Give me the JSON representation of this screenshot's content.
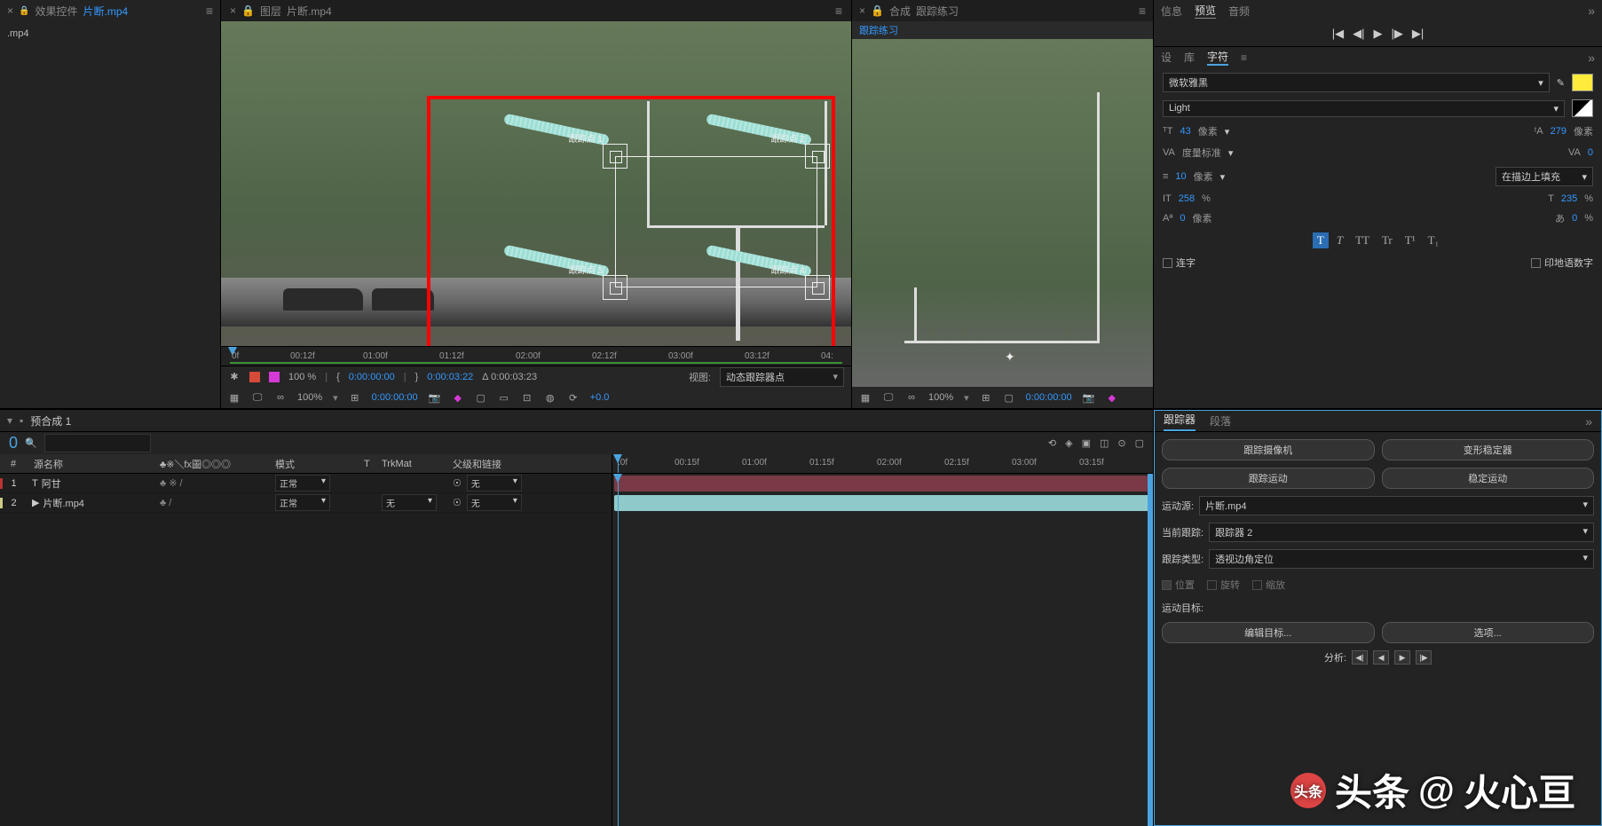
{
  "left_panel": {
    "tab_prefix": "效果控件",
    "tab_file": "片断.mp4",
    "item": ".mp4"
  },
  "center_panel": {
    "tab_prefix": "图层",
    "tab_file": "片断.mp4"
  },
  "track_points": {
    "p1": "跟踪点 1",
    "p2": "跟踪点 2",
    "p3": "跟踪点 3",
    "p4": "跟踪点 4"
  },
  "center_ruler": [
    "0f",
    "00:12f",
    "01:00f",
    "01:12f",
    "02:00f",
    "02:12f",
    "03:00f",
    "03:12f",
    "04:"
  ],
  "viewer_toolbar": {
    "pct": "100 %",
    "bracket_time": "0:00:00:00",
    "time2": "0:00:03:22",
    "delta": "Δ 0:00:03:23",
    "view_label": "视图:",
    "view_value": "动态跟踪器点"
  },
  "bottom_toolbar": {
    "zoom": "100%",
    "time": "0:00:00:00",
    "offset": "+0.0"
  },
  "comp_panel": {
    "tab_prefix": "合成",
    "tab_name": "跟踪练习",
    "subtab": "跟踪练习"
  },
  "comp_toolbar": {
    "zoom": "100%",
    "time": "0:00:00:00"
  },
  "top_side_tabs": {
    "info": "信息",
    "preview": "预览",
    "audio": "音频"
  },
  "char_side_tabs": {
    "design": "设",
    "library": "库",
    "char": "字符"
  },
  "char_panel": {
    "font": "微软雅黑",
    "weight": "Light",
    "size_val": "43",
    "size_unit": "像素",
    "lead_val": "279",
    "lead_unit": "像素",
    "kern": "度量标准",
    "track_val": "0",
    "stroke_val": "10",
    "stroke_unit": "像素",
    "stroke_opt": "在描边上填充",
    "vscale": "258",
    "hscale": "235",
    "pct": "%",
    "baseline": "0",
    "baseline_unit": "像素",
    "tsume": "0",
    "tsume_pct": "%",
    "ligatures": "连字",
    "hindi": "印地语数字"
  },
  "style_btns": {
    "t": "T",
    "i": "T",
    "tt": "TT",
    "tr": "Tr",
    "t1": "T¹",
    "t2": "T₁"
  },
  "timeline": {
    "tab": "预合成 1",
    "search_ph": "",
    "headers": {
      "num": "#",
      "src": "源名称",
      "switches": "♣※＼fx圖◎◎◎",
      "mode": "模式",
      "t": "T",
      "trkmat": "TrkMat",
      "parent": "父级和链接"
    },
    "row1": {
      "num": "1",
      "name": "阿甘",
      "sw": "♣  ※ /",
      "mode": "正常",
      "trkmat": "",
      "parent_val": "无"
    },
    "row2": {
      "num": "2",
      "name": "片断.mp4",
      "sw": "♣    /",
      "mode": "正常",
      "trkmat": "无",
      "parent_val": "无"
    },
    "ruler": [
      ":0f",
      "00:15f",
      "01:00f",
      "01:15f",
      "02:00f",
      "02:15f",
      "03:00f",
      "03:15f"
    ],
    "link_sym": "☉"
  },
  "tracker": {
    "tab1": "跟踪器",
    "tab2": "段落",
    "btn_cam": "跟踪摄像机",
    "btn_warp": "变形稳定器",
    "btn_motion": "跟踪运动",
    "btn_stable": "稳定运动",
    "src_label": "运动源:",
    "src_val": "片断.mp4",
    "cur_label": "当前跟踪:",
    "cur_val": "跟踪器 2",
    "type_label": "跟踪类型:",
    "type_val": "透视边角定位",
    "chk_pos": "位置",
    "chk_rot": "旋转",
    "chk_scale": "缩放",
    "target_label": "运动目标:",
    "btn_edit": "编辑目标...",
    "btn_opts": "选项...",
    "analysis": "分析:"
  },
  "watermark": {
    "prefix": "头条",
    "at": "@",
    "name": "火心亘"
  },
  "icons": {
    "lock": "🔒",
    "x": "×",
    "dd": "▾",
    "menu": "≡",
    "more": "»",
    "search": "🔍",
    "first": "|◀",
    "prev": "◀|",
    "play": "▶",
    "next": "|▶",
    "last": "▶|",
    "eyedrop": "✎",
    "cam": "📷",
    "link": "☉",
    "t": "T",
    "film": "▶"
  }
}
